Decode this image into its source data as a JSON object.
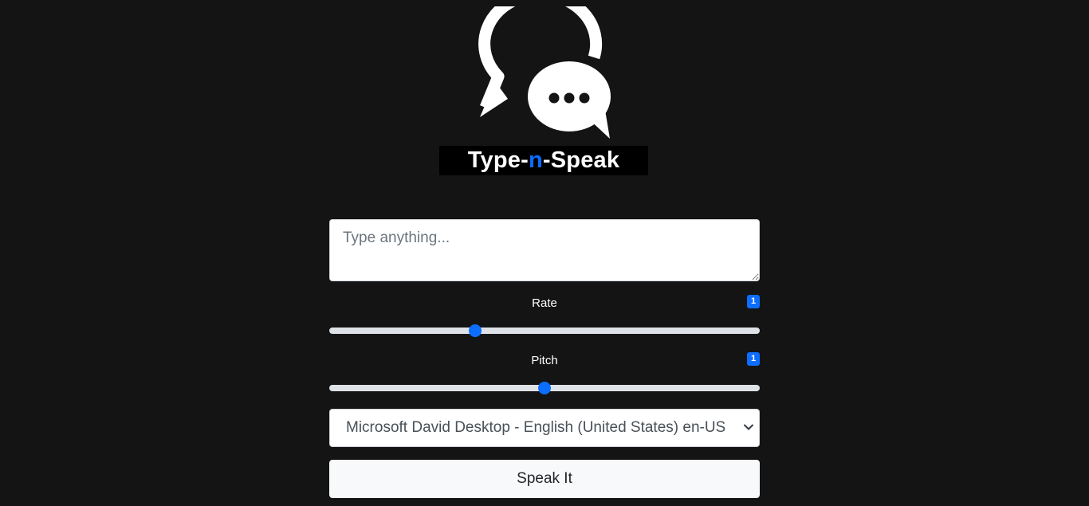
{
  "logo": {
    "text_part1": "Type-",
    "text_accent": "n",
    "text_part2": "-Speak",
    "accent_color": "#0a6cff",
    "icon": "chat-bubbles-icon"
  },
  "textarea": {
    "placeholder": "Type anything...",
    "value": ""
  },
  "rate": {
    "label": "Rate",
    "badge": "1",
    "value": 1,
    "min": 0.5,
    "max": 2
  },
  "pitch": {
    "label": "Pitch",
    "badge": "1",
    "value": 1,
    "min": 0,
    "max": 2
  },
  "voice_select": {
    "selected": "Microsoft David Desktop - English (United States) en-US"
  },
  "speak_button": {
    "label": "Speak It"
  },
  "colors": {
    "background": "#141414",
    "primary": "#0d6efd"
  }
}
